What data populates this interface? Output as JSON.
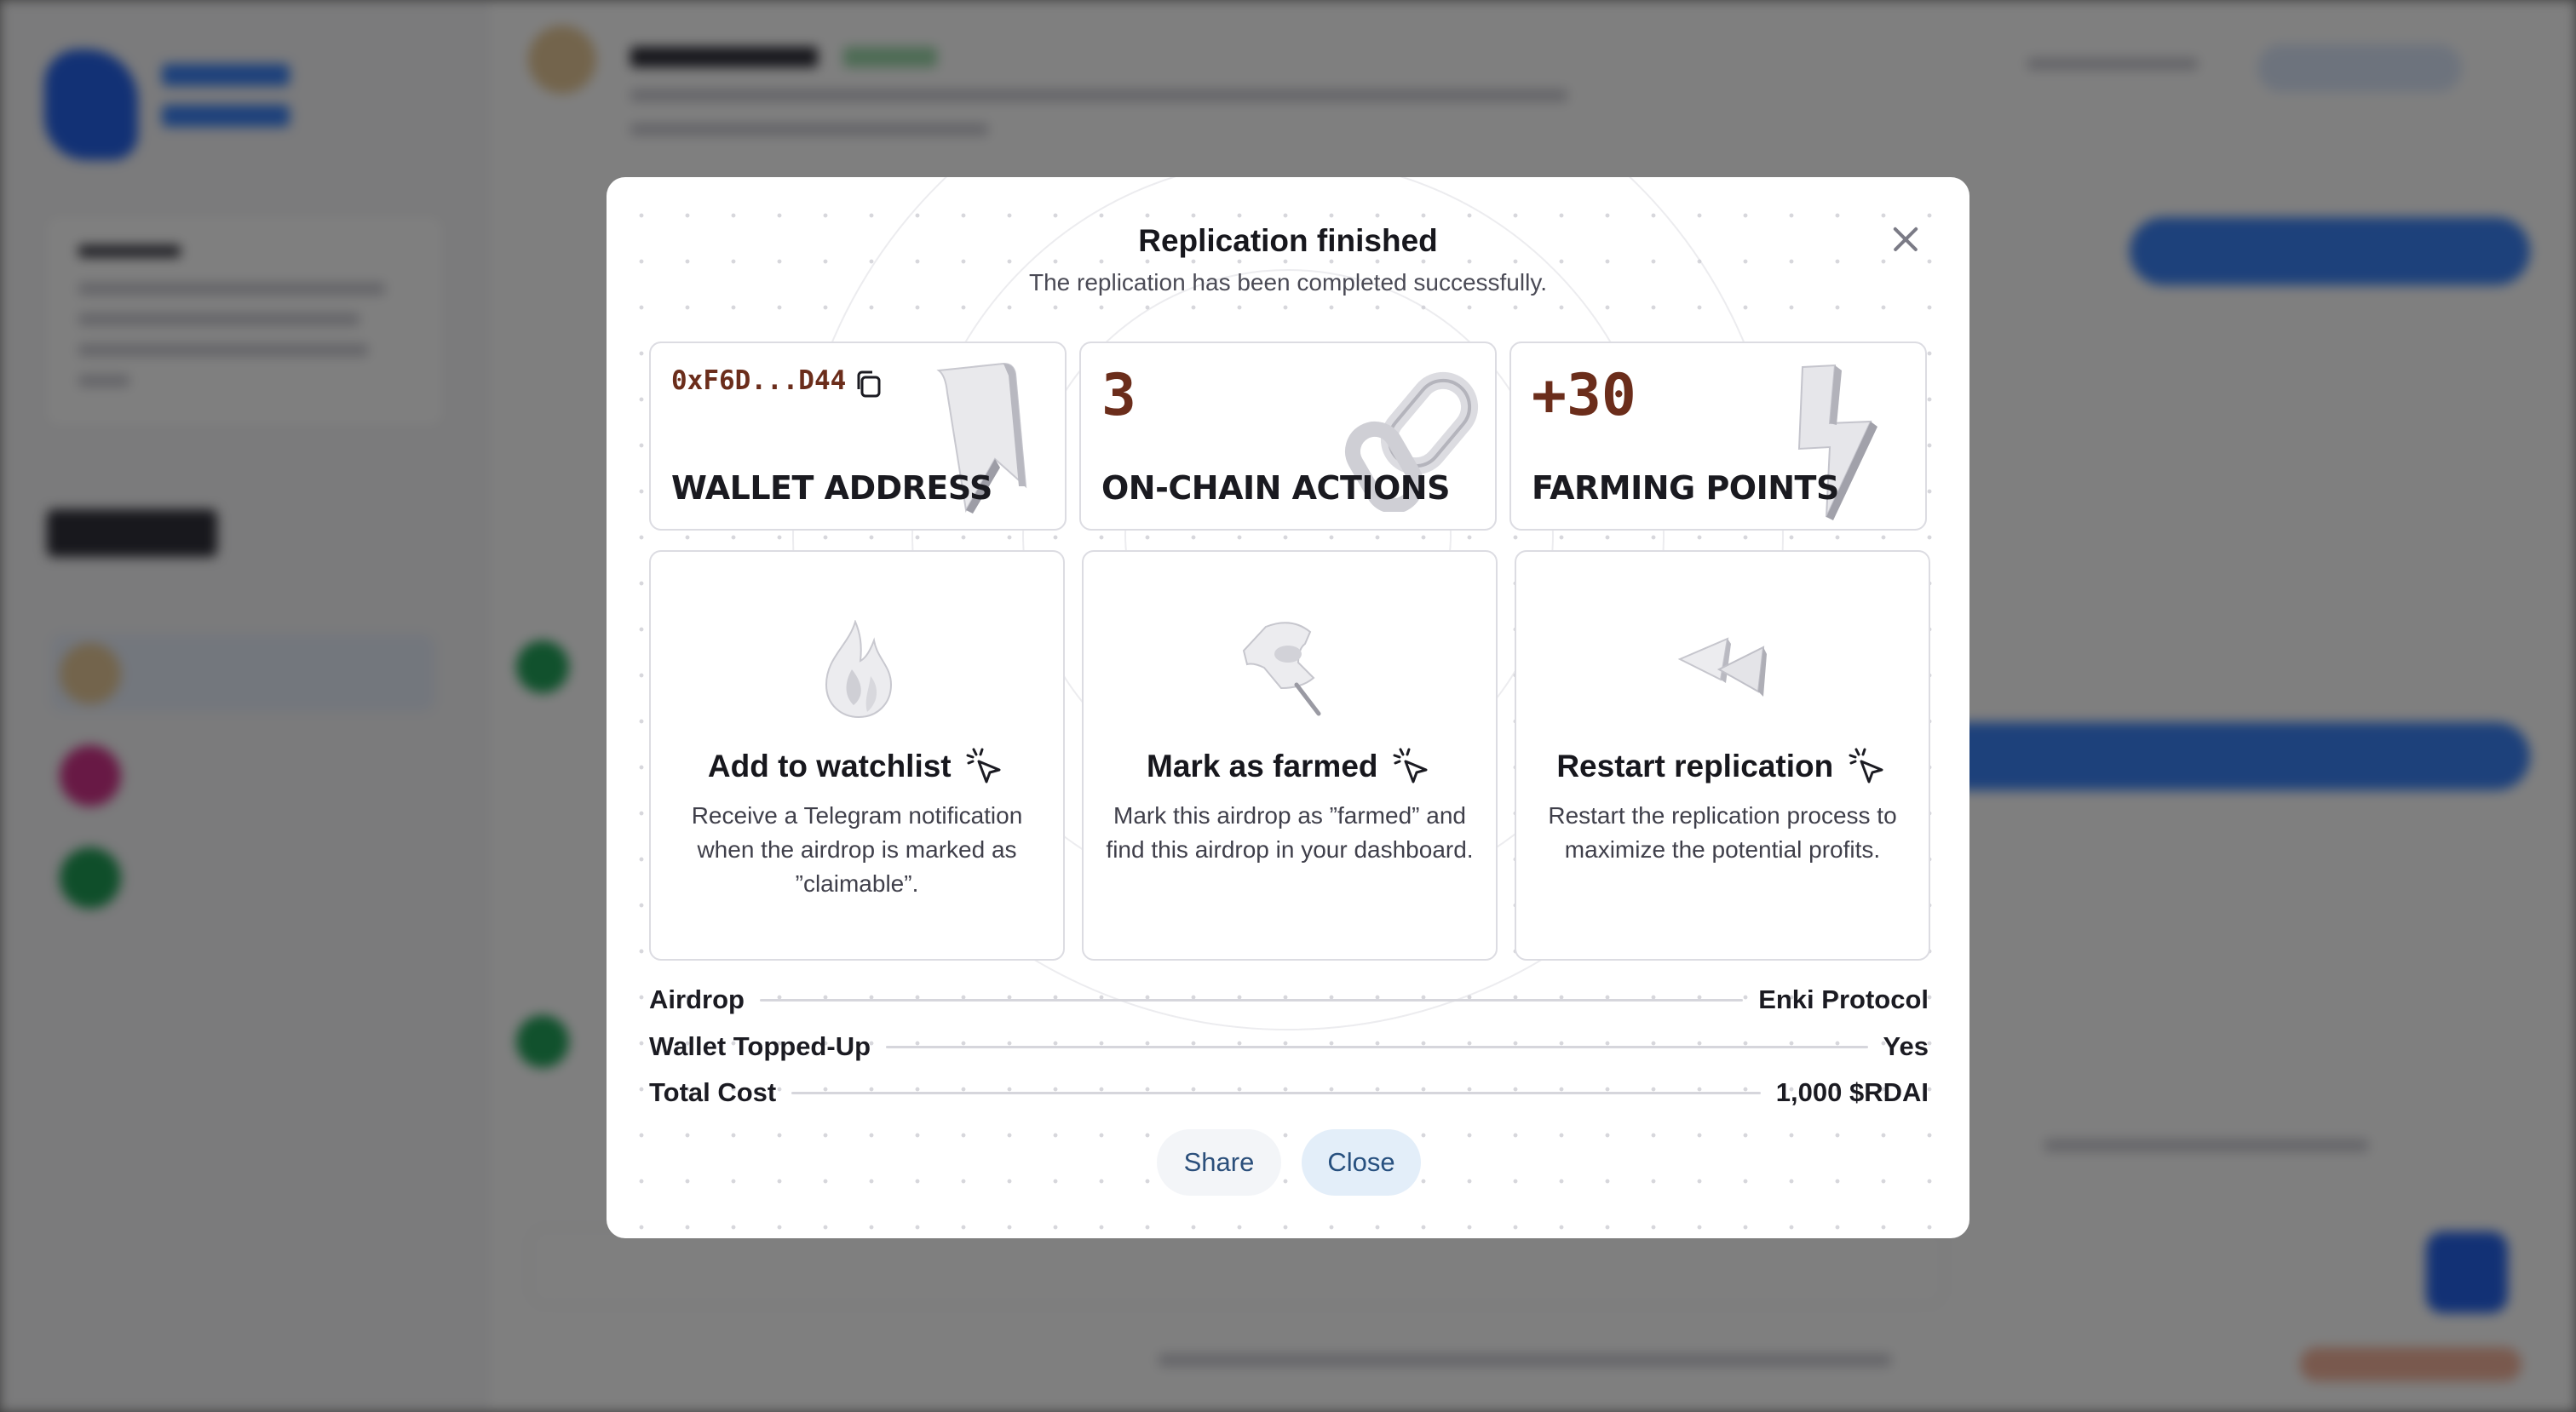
{
  "modal": {
    "title": "Replication finished",
    "subtitle": "The replication has been completed successfully."
  },
  "stats": [
    {
      "value": "0xF6D...D44",
      "label": "WALLET ADDRESS",
      "icon": "bookmark-3d-icon"
    },
    {
      "value": "3",
      "label": "ON-CHAIN ACTIONS",
      "icon": "chain-link-3d-icon"
    },
    {
      "value": "+30",
      "label": "FARMING POINTS",
      "icon": "lightning-bolt-3d-icon"
    }
  ],
  "actions": [
    {
      "title": "Add to watchlist",
      "description": "Receive a Telegram notification when the airdrop is marked as ”claimable”.",
      "icon": "flame-3d-icon"
    },
    {
      "title": "Mark as farmed",
      "description": "Mark this airdrop as ”farmed” and find this airdrop in your dashboard.",
      "icon": "push-pin-3d-icon"
    },
    {
      "title": "Restart replication",
      "description": "Restart the replication process to maximize the potential profits.",
      "icon": "rewind-3d-icon"
    }
  ],
  "details": [
    {
      "label": "Airdrop",
      "value": "Enki Protocol"
    },
    {
      "label": "Wallet Topped-Up",
      "value": "Yes"
    },
    {
      "label": "Total Cost",
      "value": "1,000 $RDAI"
    }
  ],
  "buttons": {
    "share": "Share",
    "close": "Close"
  },
  "colors": {
    "accent_value": "#6b2d1b",
    "button_text": "#2b4f7b",
    "overlay": "rgba(0,0,0,0.5)"
  }
}
